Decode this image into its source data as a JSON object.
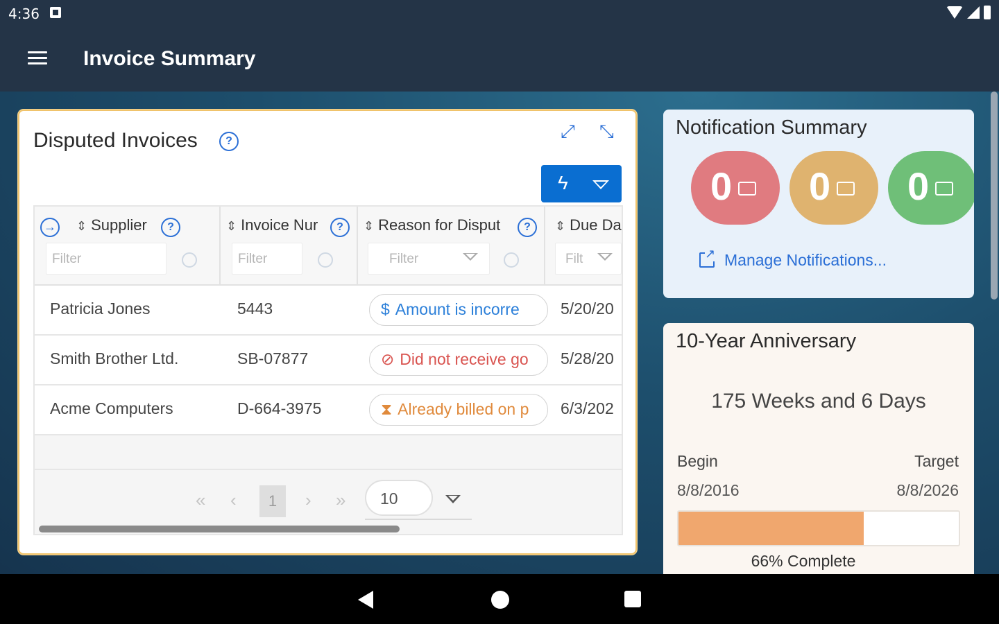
{
  "status_bar": {
    "time": "4:36"
  },
  "app_bar": {
    "title": "Invoice Summary"
  },
  "disputed": {
    "title": "Disputed Invoices",
    "help_glyph": "?",
    "action_glyph": "ϟ",
    "columns": [
      {
        "label": "Supplier",
        "filter_placeholder": "Filter"
      },
      {
        "label": "Invoice Nur",
        "filter_placeholder": "Filter"
      },
      {
        "label": "Reason for Disput",
        "filter_placeholder": "Filter"
      },
      {
        "label": "Due Da",
        "filter_placeholder": "Filt"
      }
    ],
    "rows": [
      {
        "supplier": "Patricia Jones",
        "invoice": "5443",
        "reason": "Amount is incorre",
        "reason_icon": "$",
        "reason_color": "#2b7fd9",
        "due": "5/20/20"
      },
      {
        "supplier": "Smith Brother Ltd.",
        "invoice": "SB-07877",
        "reason": "Did not receive go",
        "reason_icon": "⊘",
        "reason_color": "#d9534f",
        "due": "5/28/20"
      },
      {
        "supplier": "Acme Computers",
        "invoice": "D-664-3975",
        "reason": "Already billed on p",
        "reason_icon": "⧗",
        "reason_color": "#e08a3c",
        "due": "6/3/202"
      }
    ],
    "pager": {
      "first": "«",
      "prev": "‹",
      "current_page": "1",
      "next": "›",
      "last": "»",
      "page_size": "10"
    }
  },
  "notifications": {
    "title": "Notification Summary",
    "badges": [
      {
        "count": "0",
        "color": "#e07b80"
      },
      {
        "count": "0",
        "color": "#dfb36f"
      },
      {
        "count": "0",
        "color": "#6fbf78"
      }
    ],
    "manage_label": "Manage Notifications..."
  },
  "anniversary": {
    "title": "10-Year Anniversary",
    "duration": "175 Weeks and 6 Days",
    "begin_label": "Begin",
    "target_label": "Target",
    "begin_date": "8/8/2016",
    "target_date": "8/8/2026",
    "progress": 0.66,
    "progress_label": "66% Complete"
  },
  "colors": {
    "header": "#243447",
    "accent": "#0a6ed1",
    "progress": "#f0a76e"
  }
}
